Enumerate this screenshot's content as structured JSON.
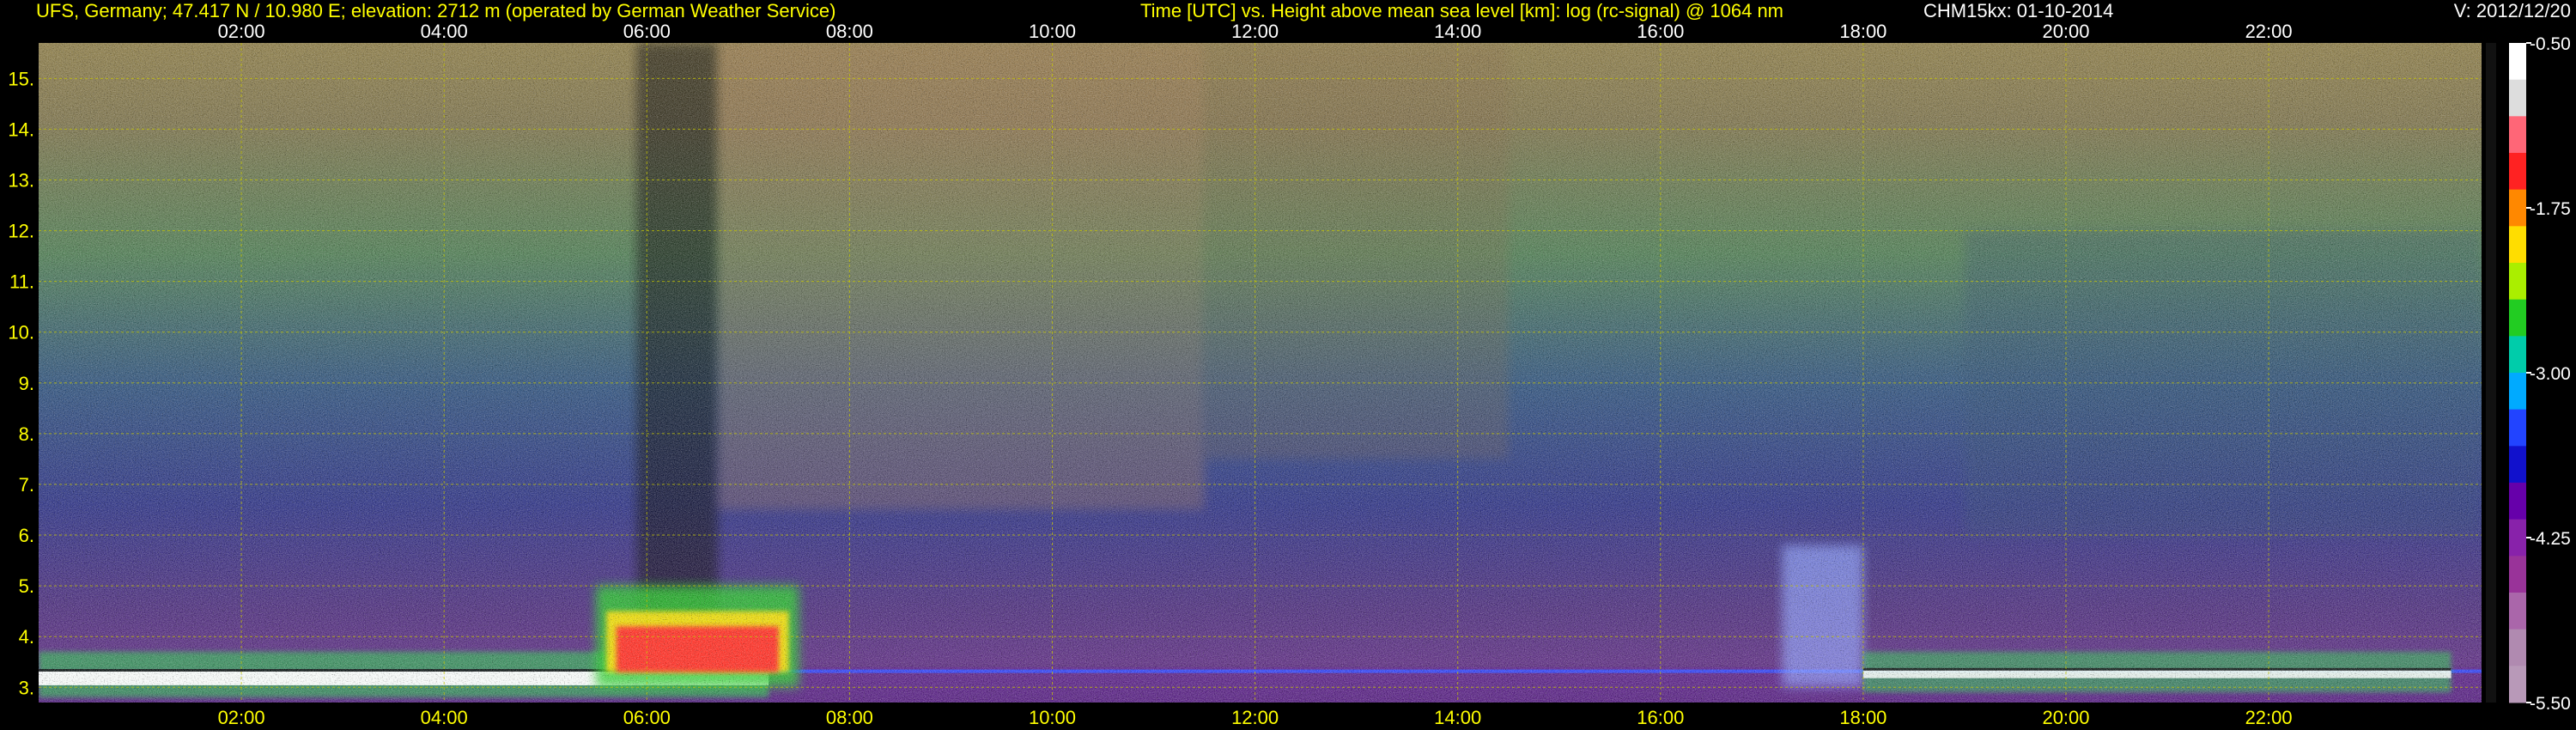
{
  "header": {
    "station": "UFS, Germany; 47.417 N / 10.980 E; elevation: 2712 m  (operated by German Weather Service)",
    "description": "Time [UTC] vs. Height above mean sea level [km]: log (rc-signal) @ 1064 nm",
    "instrument": "CHM15kx: 01-10-2014",
    "version": "V: 2012/12/20"
  },
  "colors": {
    "axis_text": "#ffff00",
    "grid": "#c8c800",
    "background": "#000000"
  },
  "chart_data": {
    "type": "heatmap",
    "title": "Time [UTC] vs. Height above mean sea level [km]: log (rc-signal) @ 1064 nm",
    "x_tick_labels": [
      "02:00",
      "04:00",
      "06:00",
      "08:00",
      "10:00",
      "12:00",
      "14:00",
      "16:00",
      "18:00",
      "20:00",
      "22:00"
    ],
    "x_range_hours": [
      0,
      24
    ],
    "y_tick_labels": [
      "3.",
      "4.",
      "5.",
      "6.",
      "7.",
      "8.",
      "9.",
      "10.",
      "11.",
      "12.",
      "13.",
      "14.",
      "15."
    ],
    "y_range_km": [
      2.7,
      15.7
    ],
    "grid": true,
    "colorbar": {
      "tick_labels": [
        "-0.50",
        "-1.75",
        "-3.00",
        "-4.25",
        "-5.50"
      ],
      "range": [
        -5.5,
        -0.5
      ],
      "colors": [
        "#ffffff",
        "#dddddd",
        "#ff6677",
        "#ff2222",
        "#ff8800",
        "#ffdd00",
        "#aaee00",
        "#22cc22",
        "#00ccaa",
        "#00aaff",
        "#2244ff",
        "#1111cc",
        "#6600aa",
        "#8822aa",
        "#993399",
        "#aa66aa",
        "#b08ab0",
        "#b899b8"
      ]
    },
    "features": [
      {
        "t_start": 0.0,
        "t_end": 7.2,
        "h_bottom": 2.8,
        "h_top": 3.6,
        "level": "-0.5"
      },
      {
        "t_start": 5.5,
        "t_end": 7.5,
        "h_bottom": 3.0,
        "h_top": 5.0,
        "level": "-1.0"
      },
      {
        "t_start": 17.2,
        "t_end": 18.0,
        "h_bottom": 3.0,
        "h_top": 5.8,
        "level": "-2.5"
      },
      {
        "t_start": 18.0,
        "t_end": 23.8,
        "h_bottom": 2.9,
        "h_top": 3.7,
        "level": "-1.5"
      }
    ]
  }
}
